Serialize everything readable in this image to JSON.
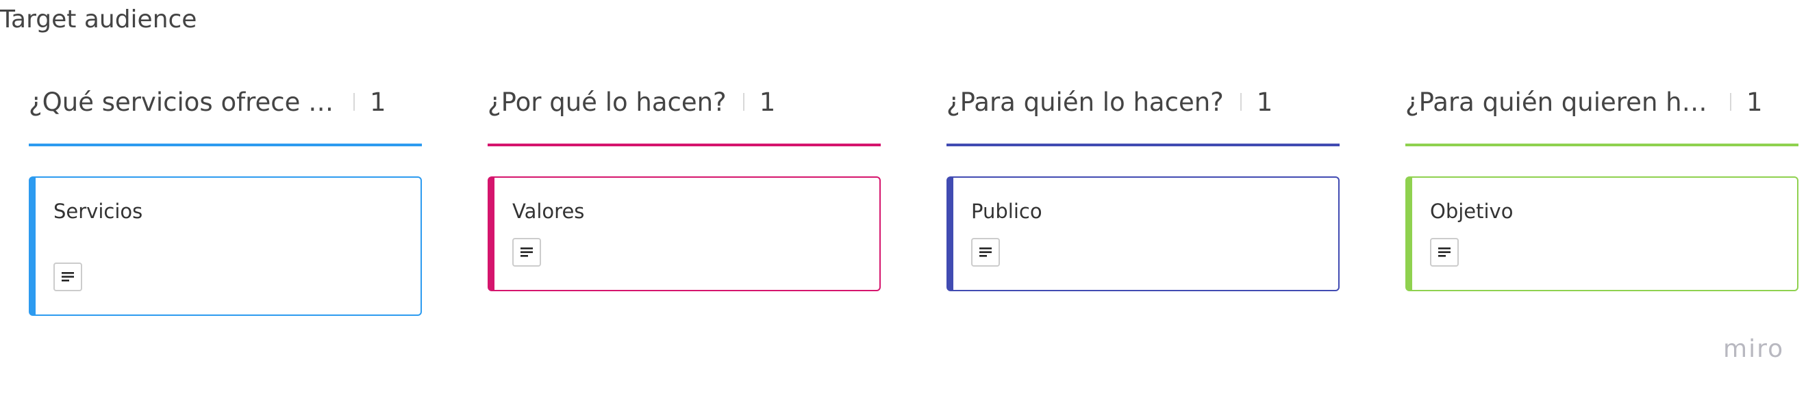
{
  "frame": {
    "title": "Target audience"
  },
  "columns": [
    {
      "title": "¿Qué servicios ofrece la e...",
      "count": "1",
      "color": "#2d9bf0",
      "card": {
        "title": "Servicios"
      }
    },
    {
      "title": "¿Por qué lo hacen?",
      "count": "1",
      "color": "#d5156d",
      "card": {
        "title": "Valores"
      }
    },
    {
      "title": "¿Para quién lo hacen?",
      "count": "1",
      "color": "#414bb2",
      "card": {
        "title": "Publico"
      }
    },
    {
      "title": "¿Para quién quieren hace...",
      "count": "1",
      "color": "#8fd14f",
      "card": {
        "title": "Objetivo"
      }
    }
  ],
  "card_icon": "description-icon",
  "brand": {
    "logo_text": "miro"
  }
}
